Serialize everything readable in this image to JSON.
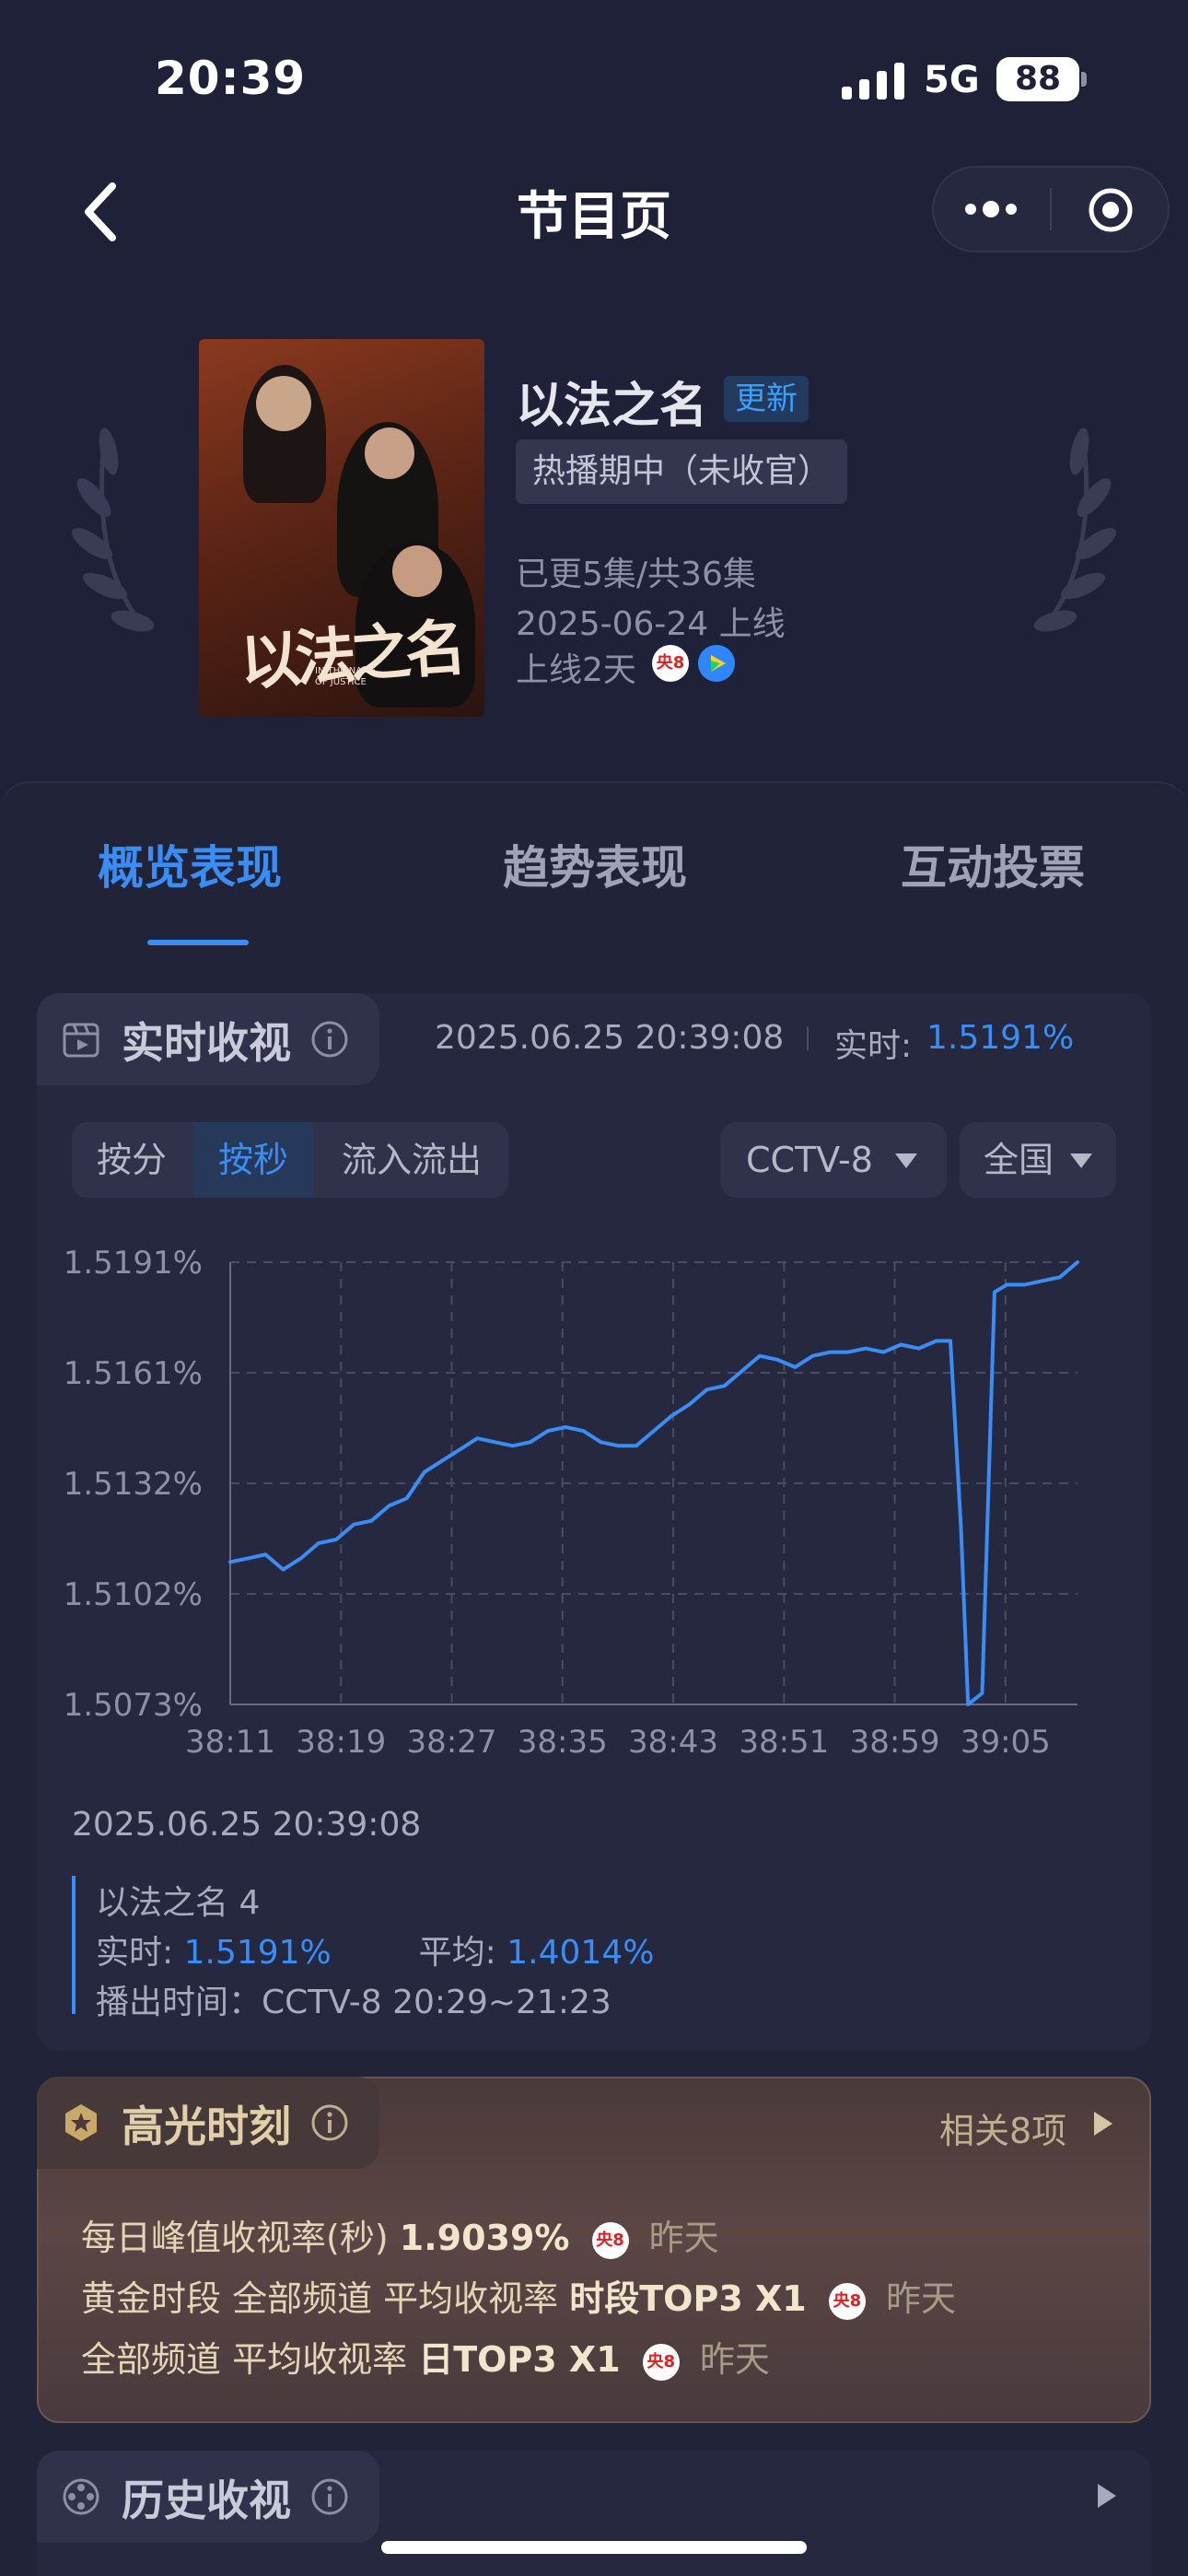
{
  "status_bar": {
    "time": "20:39",
    "network": "5G",
    "battery": "88"
  },
  "nav": {
    "title": "节目页"
  },
  "show": {
    "title": "以法之名",
    "update_badge": "更新",
    "status": "热播期中（未收官）",
    "episodes": "已更5集/共36集",
    "release": "2025-06-24 上线",
    "online_days": "上线2天",
    "channel_logo_text": "央8",
    "poster_title": "以法之名",
    "poster_subtitle": "IN THE NAME OF JUSTICE"
  },
  "tabs": [
    "概览表现",
    "趋势表现",
    "互动投票"
  ],
  "realtime": {
    "title": "实时收视",
    "timestamp": "2025.06.25 20:39:08",
    "realtime_label": "实时:",
    "realtime_value": "1.5191%",
    "segments": [
      "按分",
      "按秒",
      "流入流出"
    ],
    "active_segment": "按秒",
    "channel": "CCTV-8",
    "region": "全国"
  },
  "chart_data": {
    "type": "line",
    "y_tick_labels": [
      "1.5191%",
      "1.5161%",
      "1.5132%",
      "1.5102%",
      "1.5073%"
    ],
    "ylim": [
      1.5073,
      1.5191
    ],
    "x_tick_labels": [
      "38:11",
      "38:19",
      "38:27",
      "38:35",
      "38:43",
      "38:51",
      "38:59",
      "39:05"
    ],
    "grid": true,
    "series": [
      {
        "color": "#3a8df5",
        "points": [
          [
            0,
            1.5111
          ],
          [
            1,
            1.5112
          ],
          [
            2,
            1.5113
          ],
          [
            3,
            1.5109
          ],
          [
            4,
            1.5112
          ],
          [
            5,
            1.5116
          ],
          [
            6,
            1.5117
          ],
          [
            7,
            1.5121
          ],
          [
            8,
            1.5122
          ],
          [
            9,
            1.5126
          ],
          [
            10,
            1.5128
          ],
          [
            11,
            1.5135
          ],
          [
            12,
            1.5138
          ],
          [
            13,
            1.5141
          ],
          [
            14,
            1.5144
          ],
          [
            15,
            1.5143
          ],
          [
            16,
            1.5142
          ],
          [
            17,
            1.5143
          ],
          [
            18,
            1.5146
          ],
          [
            19,
            1.5147
          ],
          [
            20,
            1.5146
          ],
          [
            21,
            1.5143
          ],
          [
            22,
            1.5142
          ],
          [
            23,
            1.5142
          ],
          [
            24,
            1.5146
          ],
          [
            25,
            1.515
          ],
          [
            26,
            1.5153
          ],
          [
            27,
            1.5157
          ],
          [
            28,
            1.5158
          ],
          [
            29,
            1.5162
          ],
          [
            30,
            1.5166
          ],
          [
            31,
            1.5165
          ],
          [
            32,
            1.5163
          ],
          [
            33,
            1.5166
          ],
          [
            34,
            1.5167
          ],
          [
            35,
            1.5167
          ],
          [
            36,
            1.5168
          ],
          [
            37,
            1.5167
          ],
          [
            38,
            1.5169
          ],
          [
            39,
            1.5168
          ],
          [
            40,
            1.517
          ],
          [
            40.8,
            1.517
          ],
          [
            41.4,
            1.512
          ],
          [
            41.8,
            1.5073
          ],
          [
            42.6,
            1.5076
          ],
          [
            43.3,
            1.5183
          ],
          [
            44,
            1.5185
          ],
          [
            45,
            1.5185
          ],
          [
            46,
            1.5186
          ],
          [
            47,
            1.5187
          ],
          [
            48,
            1.5191
          ]
        ]
      }
    ]
  },
  "tooltip": {
    "date": "2025.06.25 20:39:08",
    "program": "以法之名 4",
    "realtime_label": "实时:",
    "realtime_value": "1.5191%",
    "average_label": "平均:",
    "average_value": "1.4014%",
    "airtime": "播出时间：CCTV-8 20:29~21:23"
  },
  "highlights": {
    "title": "高光时刻",
    "more": "相关8项",
    "rows": [
      {
        "text": "每日峰值收视率(秒)",
        "bold": "1.9039%",
        "logo": "央8",
        "when": "昨天"
      },
      {
        "text": "黄金时段 全部频道 平均收视率",
        "bold": "时段TOP3 X1",
        "logo": "央8",
        "when": "昨天"
      },
      {
        "text": "全部频道 平均收视率",
        "bold": "日TOP3 X1",
        "logo": "央8",
        "when": "昨天"
      }
    ]
  },
  "history": {
    "title": "历史收视"
  },
  "colors": {
    "accent": "#3a8df5",
    "background": "#1f2139",
    "card": "#262840",
    "highlight_gold": "#e0cfa8"
  }
}
